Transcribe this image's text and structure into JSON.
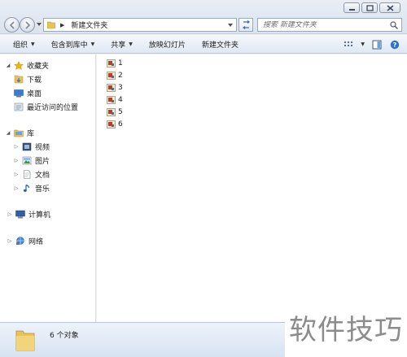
{
  "window": {
    "minimize_icon": "minimize-icon",
    "maximize_icon": "maximize-icon",
    "close_icon": "close-icon"
  },
  "address_bar": {
    "path": "新建文件夹",
    "search_placeholder": "搜索 新建文件夹"
  },
  "toolbar": {
    "organize": "组织",
    "include_in_library": "包含到库中",
    "share": "共享",
    "slideshow": "放映幻灯片",
    "new_folder": "新建文件夹"
  },
  "nav": {
    "favorites": "收藏夹",
    "downloads": "下载",
    "desktop": "桌面",
    "recent_places": "最近访问的位置",
    "libraries": "库",
    "videos": "视频",
    "pictures": "图片",
    "documents": "文档",
    "music": "音乐",
    "computer": "计算机",
    "network": "网络"
  },
  "files": [
    "1",
    "2",
    "3",
    "4",
    "5",
    "6"
  ],
  "status": {
    "count_text": "6 个对象"
  },
  "watermark": "软件技巧",
  "colors": {
    "accent": "#dbe3ee",
    "folder": "#e8c25a",
    "star": "#f2b600",
    "selection": "#ffffff"
  }
}
